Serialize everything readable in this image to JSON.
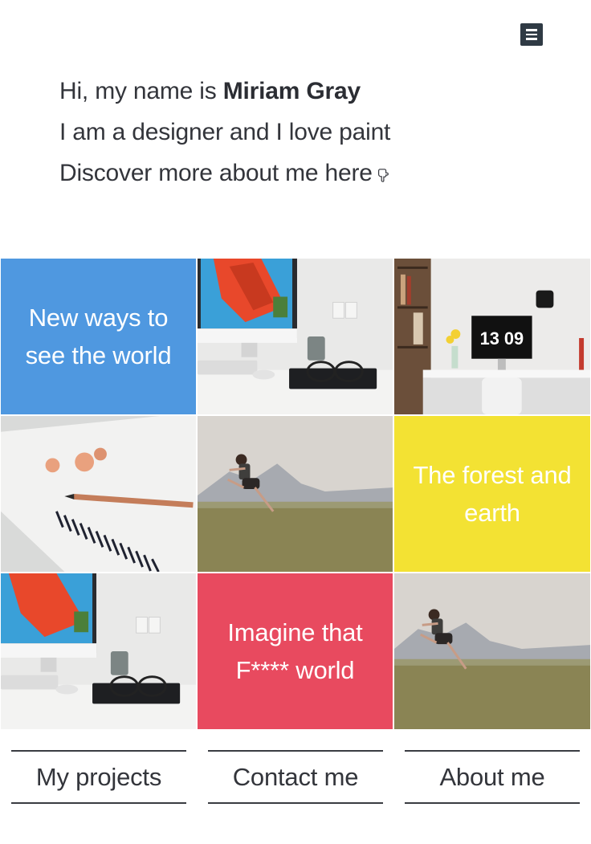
{
  "header": {
    "menu_icon": "hamburger-menu-icon"
  },
  "intro": {
    "line1_prefix": "Hi, my name is ",
    "name": "Miriam Gray",
    "line2": "I am a designer and I love paint",
    "line3": "Discover more about me here",
    "pointer_icon": "hand-pointing-down-icon"
  },
  "tiles": {
    "tile1_text": "New ways to see the world",
    "tile6_text": "The forest and earth",
    "tile8_text": "Imagine that F**** world"
  },
  "colors": {
    "blue": "#4f98e0",
    "yellow": "#f3e233",
    "pink": "#e84a5f",
    "menu": "#2f3a44"
  },
  "clock": {
    "time": "13 09"
  },
  "nav": {
    "projects": "My projects",
    "contact": "Contact me",
    "about": "About me"
  }
}
